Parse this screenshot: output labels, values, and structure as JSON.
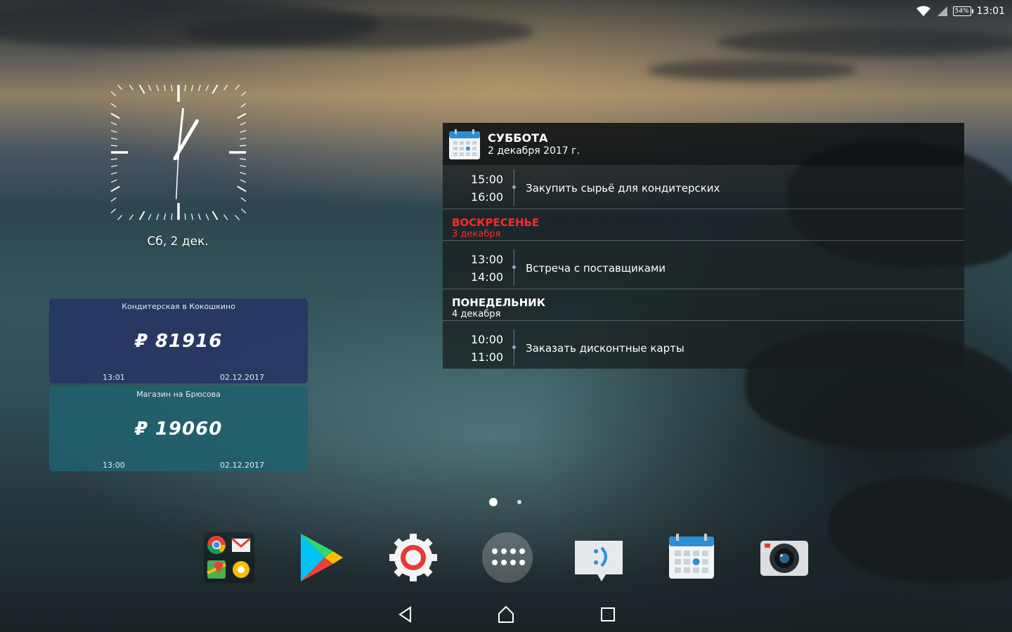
{
  "status_bar": {
    "battery_level": "54%",
    "time": "13:01",
    "wifi_icon": "wifi-icon",
    "signal_icon": "signal-icon"
  },
  "clock_widget": {
    "date_label": "Сб, 2 дек.",
    "hour": 13,
    "minute": 1
  },
  "balance_widgets": [
    {
      "name": "Кондитерская в Кокошкино",
      "amount": "₽ 81916",
      "time": "13:01",
      "date": "02.12.2017",
      "color": "#263464"
    },
    {
      "name": "Магазин на Брюсова",
      "amount": "₽ 19060",
      "time": "13:00",
      "date": "02.12.2017",
      "color": "#1e626e"
    }
  ],
  "calendar_widget": {
    "header": {
      "day_name": "СУББОТА",
      "date": "2 декабря 2017 г."
    },
    "days": [
      {
        "events": [
          {
            "start": "15:00",
            "end": "16:00",
            "title": "Закупить сырьё для кондитерских"
          }
        ]
      },
      {
        "day_name": "ВОСКРЕСЕНЬЕ",
        "date": "3 декабря",
        "highlight_color": "#ff2a2a",
        "events": [
          {
            "start": "13:00",
            "end": "14:00",
            "title": "Встреча с поставщиками"
          }
        ]
      },
      {
        "day_name": "ПОНЕДЕЛЬНИК",
        "date": "4 декабря",
        "events": [
          {
            "start": "10:00",
            "end": "11:00",
            "title": "Заказать дисконтные карты"
          }
        ]
      }
    ]
  },
  "home_pager": {
    "pages": 2,
    "current": 1
  },
  "dock": {
    "items": [
      {
        "name": "google-apps-folder",
        "icons": [
          "chrome-icon",
          "gmail-icon",
          "maps-icon",
          "photos-icon"
        ]
      },
      {
        "name": "play-store-icon"
      },
      {
        "name": "settings-gear-icon"
      },
      {
        "name": "app-drawer-icon"
      },
      {
        "name": "messaging-icon"
      },
      {
        "name": "calendar-icon"
      },
      {
        "name": "camera-icon"
      }
    ]
  },
  "nav_bar": {
    "back": "back-icon",
    "home": "home-icon",
    "recents": "recents-icon"
  }
}
